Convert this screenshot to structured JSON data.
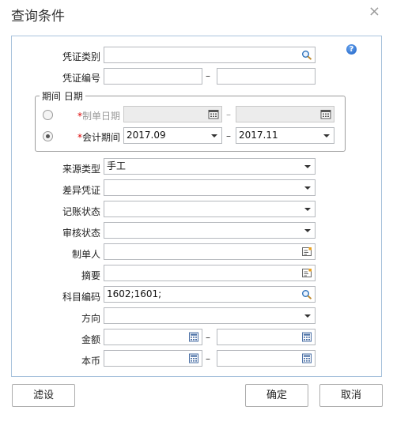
{
  "dialog": {
    "title": "查询条件",
    "close_glyph": "×",
    "help_glyph": "?"
  },
  "fields": {
    "voucher_type": {
      "label": "凭证类别",
      "value": ""
    },
    "voucher_no": {
      "label": "凭证编号",
      "from": "",
      "to": ""
    },
    "period_group": {
      "legend": "期间 日期",
      "option_date": {
        "label": "制单日期",
        "selected": false
      },
      "option_period": {
        "label": "会计期间",
        "selected": true,
        "from": "2017.09",
        "to": "2017.11"
      }
    },
    "source_type": {
      "label": "来源类型",
      "value": "手工"
    },
    "diff_voucher": {
      "label": "差异凭证",
      "value": ""
    },
    "posting_status": {
      "label": "记账状态",
      "value": ""
    },
    "audit_status": {
      "label": "审核状态",
      "value": ""
    },
    "maker": {
      "label": "制单人",
      "value": ""
    },
    "summary": {
      "label": "摘要",
      "value": ""
    },
    "account_code": {
      "label": "科目编码",
      "value": "1602;1601;"
    },
    "direction": {
      "label": "方向",
      "value": ""
    },
    "amount": {
      "label": "金额",
      "from": "",
      "to": ""
    },
    "local_currency": {
      "label": "本币",
      "from": "",
      "to": ""
    }
  },
  "range_separator": "–",
  "required_mark": "*",
  "buttons": {
    "filter": "滤设",
    "ok": "确定",
    "cancel": "取消"
  },
  "colors": {
    "panel_border": "#a9c3dd",
    "required": "#dd0000",
    "help_icon": "#1b5fc4"
  }
}
